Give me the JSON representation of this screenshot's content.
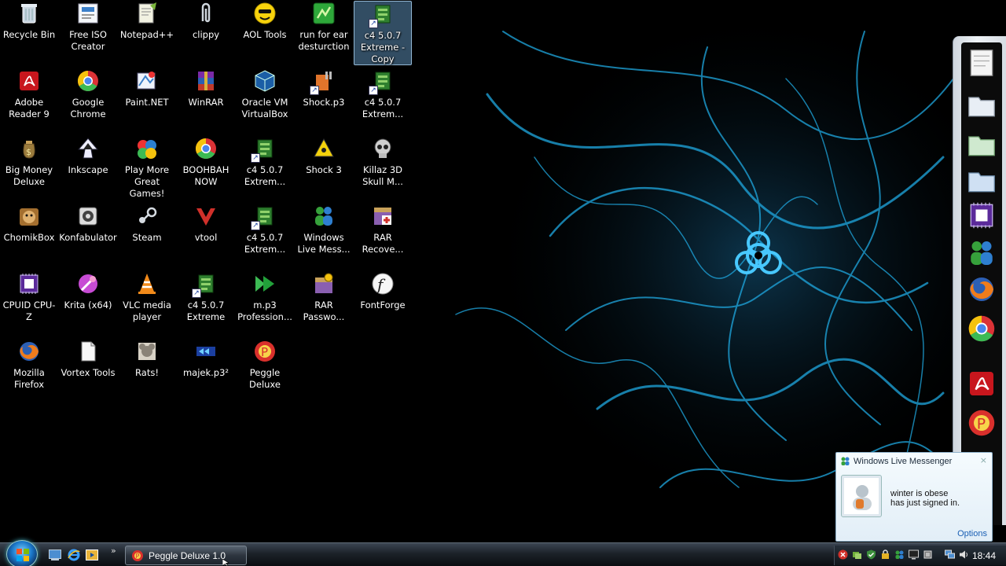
{
  "desktop": {
    "icons": [
      {
        "label": "Recycle Bin",
        "icon": "recycle-bin-icon"
      },
      {
        "label": "Free ISO Creator",
        "icon": "iso-creator-icon"
      },
      {
        "label": "Notepad++",
        "icon": "notepad-plus-plus-icon"
      },
      {
        "label": "clippy",
        "icon": "paperclip-icon"
      },
      {
        "label": "AOL Tools",
        "icon": "aol-smiley-icon"
      },
      {
        "label": "run for ear desturction",
        "icon": "green-game-icon"
      },
      {
        "label": "c4 5.0.7 Extreme - Copy",
        "icon": "c4-extreme-icon",
        "selected": true
      },
      {
        "label": "Adobe Reader 9",
        "icon": "adobe-reader-icon"
      },
      {
        "label": "Google Chrome",
        "icon": "chrome-icon"
      },
      {
        "label": "Paint.NET",
        "icon": "paint-net-icon"
      },
      {
        "label": "WinRAR",
        "icon": "winrar-icon"
      },
      {
        "label": "Oracle VM VirtualBox",
        "icon": "virtualbox-icon"
      },
      {
        "label": "Shock.p3",
        "icon": "shock-p3-icon"
      },
      {
        "label": "c4 5.0.7 Extrem...",
        "icon": "c4-extreme-icon"
      },
      {
        "label": "Big Money Deluxe",
        "icon": "money-bag-icon"
      },
      {
        "label": "Inkscape",
        "icon": "inkscape-icon"
      },
      {
        "label": "Play More Great Games!",
        "icon": "games-icon"
      },
      {
        "label": "BOOHBAH NOW",
        "icon": "chrome-icon"
      },
      {
        "label": "c4 5.0.7 Extrem...",
        "icon": "c4-extreme-icon"
      },
      {
        "label": "Shock 3",
        "icon": "radiation-icon"
      },
      {
        "label": "Killaz 3D Skull M...",
        "icon": "skull-icon"
      },
      {
        "label": "ChomikBox",
        "icon": "hamster-icon"
      },
      {
        "label": "Konfabulator",
        "icon": "konfabulator-icon"
      },
      {
        "label": "Steam",
        "icon": "steam-icon"
      },
      {
        "label": "vtool",
        "icon": "vtool-icon"
      },
      {
        "label": "c4 5.0.7 Extrem...",
        "icon": "c4-extreme-icon"
      },
      {
        "label": "Windows Live Mess...",
        "icon": "messenger-icon"
      },
      {
        "label": "RAR Recove...",
        "icon": "rar-recovery-icon"
      },
      {
        "label": "CPUID CPU-Z",
        "icon": "cpu-z-icon"
      },
      {
        "label": "Krita (x64)",
        "icon": "krita-icon"
      },
      {
        "label": "VLC media player",
        "icon": "vlc-cone-icon"
      },
      {
        "label": "c4 5.0.7 Extreme",
        "icon": "c4-extreme-icon"
      },
      {
        "label": "m.p3 Profession...",
        "icon": "green-arrow-icon"
      },
      {
        "label": "RAR Passwo...",
        "icon": "rar-password-icon"
      },
      {
        "label": "FontForge",
        "icon": "fontforge-icon"
      },
      {
        "label": "Mozilla Firefox",
        "icon": "firefox-icon"
      },
      {
        "label": "Vortex Tools",
        "icon": "document-icon"
      },
      {
        "label": "Rats!",
        "icon": "rats-icon"
      },
      {
        "label": "majek.p3²",
        "icon": "majek-icon"
      },
      {
        "label": "Peggle Deluxe",
        "icon": "peggle-icon"
      }
    ]
  },
  "sidebar": {
    "items": [
      {
        "icon": "notes-icon"
      },
      {
        "icon": "folder-icon"
      },
      {
        "icon": "folder-green-icon"
      },
      {
        "icon": "folder-blue-icon"
      },
      {
        "icon": "cpu-z-icon"
      },
      {
        "icon": "messenger-icon"
      },
      {
        "icon": "firefox-icon"
      },
      {
        "icon": "chrome-icon"
      },
      {
        "icon": "adobe-reader-icon"
      },
      {
        "icon": "peggle-icon"
      }
    ]
  },
  "toast": {
    "title": "Windows Live Messenger",
    "line1": "winter is obese",
    "line2": "has just signed in.",
    "options": "Options",
    "close": "×"
  },
  "taskbar": {
    "task_label": "Peggle Deluxe 1.0",
    "more": "»",
    "clock": "18:44"
  },
  "colors": {
    "wallpaper_accent": "#1fa8e0",
    "selection": "#6eaadc"
  }
}
